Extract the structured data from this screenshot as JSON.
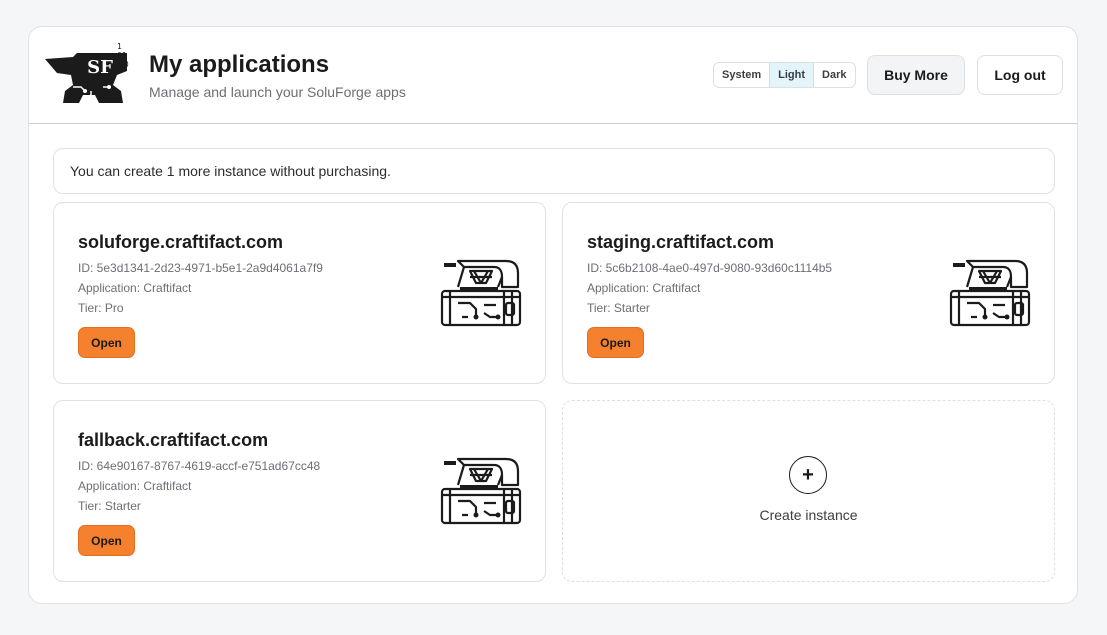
{
  "header": {
    "logo_text": "SF",
    "logo_bits": [
      "1",
      "01",
      "10"
    ],
    "title": "My applications",
    "subtitle": "Manage and launch your SoluForge apps",
    "theme_options": [
      "System",
      "Light",
      "Dark"
    ],
    "theme_selected": "Light",
    "buy_more_label": "Buy More",
    "logout_label": "Log out"
  },
  "notice": "You can create 1 more instance without purchasing.",
  "instances": [
    {
      "name": "soluforge.craftifact.com",
      "id_line": "ID: 5e3d1341-2d23-4971-b5e1-2a9d4061a7f9",
      "app_line": "Application: Craftifact",
      "tier_line": "Tier: Pro",
      "open_label": "Open"
    },
    {
      "name": "staging.craftifact.com",
      "id_line": "ID: 5c6b2108-4ae0-497d-9080-93d60c1114b5",
      "app_line": "Application: Craftifact",
      "tier_line": "Tier: Starter",
      "open_label": "Open"
    },
    {
      "name": "fallback.craftifact.com",
      "id_line": "ID: 64e90167-8767-4619-accf-e751ad67cc48",
      "app_line": "Application: Craftifact",
      "tier_line": "Tier: Starter",
      "open_label": "Open"
    }
  ],
  "create": {
    "icon": "plus-icon",
    "plus_glyph": "+",
    "label": "Create instance"
  },
  "colors": {
    "accent_orange": "#f5812e",
    "active_theme_bg": "#e3f5fb"
  }
}
